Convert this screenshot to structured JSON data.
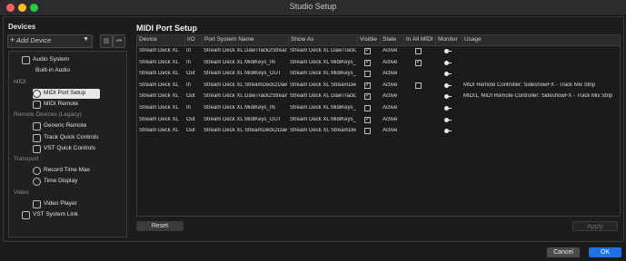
{
  "window": {
    "title": "Studio Setup"
  },
  "sidebar": {
    "heading": "Devices",
    "add_device": "Add Device",
    "tree": [
      {
        "kind": "item",
        "label": "Audio System",
        "icon": "audio-system-icon"
      },
      {
        "kind": "item",
        "label": "Built-in Audio",
        "icon": ""
      },
      {
        "kind": "group",
        "label": "MIDI"
      },
      {
        "kind": "item",
        "label": "MIDI Port Setup",
        "icon": "midi-port-icon",
        "selected": true
      },
      {
        "kind": "item",
        "label": "MIDI Remote",
        "icon": "midi-remote-icon"
      },
      {
        "kind": "group",
        "label": "Remote Devices (Legacy)"
      },
      {
        "kind": "item",
        "label": "Generic Remote",
        "icon": "generic-remote-icon"
      },
      {
        "kind": "item",
        "label": "Track Quick Controls",
        "icon": "quick-controls-icon"
      },
      {
        "kind": "item",
        "label": "VST Quick Controls",
        "icon": "quick-controls-icon"
      },
      {
        "kind": "group",
        "label": "Transport"
      },
      {
        "kind": "item",
        "label": "Record Time Max",
        "icon": "clock-icon"
      },
      {
        "kind": "item",
        "label": "Time Display",
        "icon": "clock-icon"
      },
      {
        "kind": "group",
        "label": "Video"
      },
      {
        "kind": "item",
        "label": "Video Player",
        "icon": "video-icon"
      },
      {
        "kind": "item",
        "label": "VST System Link",
        "icon": "link-icon"
      }
    ]
  },
  "main": {
    "title": "MIDI Port Setup",
    "columns": [
      "Device",
      "I/O",
      "Port System Name",
      "Show As",
      "Visible",
      "State",
      "In All MIDI",
      "Monitor",
      "Usage"
    ],
    "rows": [
      {
        "device": "Stream Deck XL",
        "io": "In",
        "port": "Stream Deck XL DawTrack2StreamDe",
        "show_as": "Stream Deck XL DawTrack2S",
        "visible": true,
        "state": "Active",
        "in_all": false,
        "usage": ""
      },
      {
        "device": "Stream Deck XL",
        "io": "In",
        "port": "Stream Deck XL MidiKeys_IN",
        "show_as": "Stream Deck XL MidiKeys_IN",
        "visible": true,
        "state": "Active",
        "in_all": true,
        "usage": ""
      },
      {
        "device": "Stream Deck XL",
        "io": "Out",
        "port": "Stream Deck XL MidiKeys_OUT",
        "show_as": "Stream Deck XL MidiKeys_OU",
        "visible": false,
        "state": "Active",
        "in_all": null,
        "usage": ""
      },
      {
        "device": "Stream Deck XL",
        "io": "In",
        "port": "Stream Deck XL StreamDeck2DawTra",
        "show_as": "Stream Deck XL StreamDeck",
        "visible": true,
        "state": "Active",
        "in_all": false,
        "usage": "MIDI Remote Controller: SideshowFX - Track Mix Strip"
      },
      {
        "device": "Stream Deck XL",
        "io": "Out",
        "port": "Stream Deck XL DawTrack2StreamDe",
        "show_as": "Stream Deck XL DawTrack2S",
        "visible": true,
        "state": "Active",
        "in_all": null,
        "usage": "MIDI1, MIDI Remote Controller: SideshowFX - Track Mix Strip"
      },
      {
        "device": "Stream Deck XL",
        "io": "In",
        "port": "Stream Deck XL MidiKeys_IN",
        "show_as": "Stream Deck XL MidiKeys_IN",
        "visible": false,
        "state": "Active",
        "in_all": null,
        "usage": ""
      },
      {
        "device": "Stream Deck XL",
        "io": "Out",
        "port": "Stream Deck XL MidiKeys_OUT",
        "show_as": "Stream Deck XL MidiKeys_OU",
        "visible": true,
        "state": "Active",
        "in_all": null,
        "usage": ""
      },
      {
        "device": "Stream Deck XL",
        "io": "Out",
        "port": "Stream Deck XL StreamDeck2DawTra",
        "show_as": "Stream Deck XL StreamDeck",
        "visible": false,
        "state": "Active",
        "in_all": null,
        "usage": ""
      }
    ]
  },
  "buttons": {
    "reset": "Reset",
    "apply": "Apply",
    "cancel": "Cancel",
    "ok": "OK"
  },
  "colors": {
    "accent": "#1f6fe5",
    "selection": "#e7e7e7"
  }
}
